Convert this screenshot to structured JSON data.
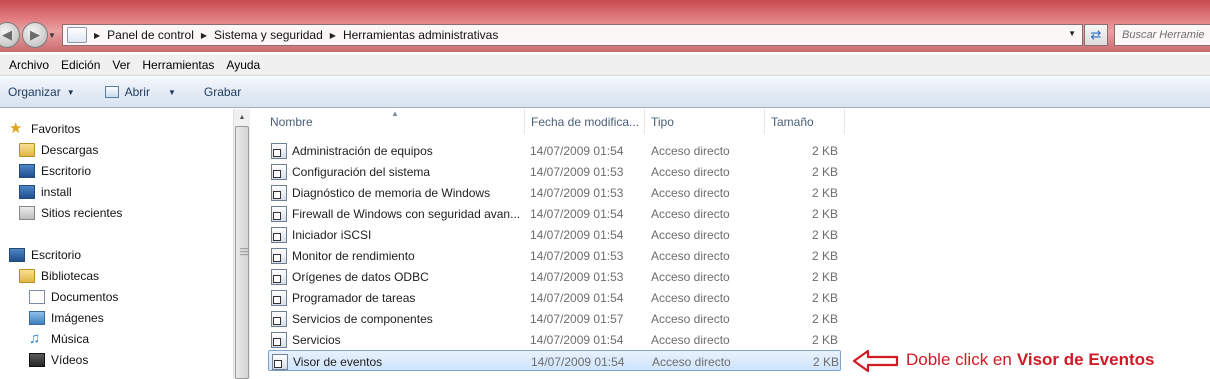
{
  "address": {
    "crumbs": [
      "Panel de control",
      "Sistema y seguridad",
      "Herramientas administrativas"
    ],
    "search_placeholder": "Buscar Herramie"
  },
  "menubar": [
    "Archivo",
    "Edición",
    "Ver",
    "Herramientas",
    "Ayuda"
  ],
  "commandbar": {
    "organize": "Organizar",
    "open": "Abrir",
    "burn": "Grabar"
  },
  "navpane": {
    "favorites": "Favoritos",
    "downloads": "Descargas",
    "desktop_fav": "Escritorio",
    "install": "install",
    "recent": "Sitios recientes",
    "desktop": "Escritorio",
    "libraries": "Bibliotecas",
    "documents": "Documentos",
    "images": "Imágenes",
    "music": "Música",
    "videos": "Vídeos"
  },
  "columns": {
    "name": "Nombre",
    "date": "Fecha de modifica...",
    "type": "Tipo",
    "size": "Tamaño"
  },
  "files": [
    {
      "name": "Administración de equipos",
      "date": "14/07/2009 01:54",
      "type": "Acceso directo",
      "size": "2 KB"
    },
    {
      "name": "Configuración del sistema",
      "date": "14/07/2009 01:53",
      "type": "Acceso directo",
      "size": "2 KB"
    },
    {
      "name": "Diagnóstico de memoria de Windows",
      "date": "14/07/2009 01:53",
      "type": "Acceso directo",
      "size": "2 KB"
    },
    {
      "name": "Firewall de Windows con seguridad avan...",
      "date": "14/07/2009 01:54",
      "type": "Acceso directo",
      "size": "2 KB"
    },
    {
      "name": "Iniciador iSCSI",
      "date": "14/07/2009 01:54",
      "type": "Acceso directo",
      "size": "2 KB"
    },
    {
      "name": "Monitor de rendimiento",
      "date": "14/07/2009 01:53",
      "type": "Acceso directo",
      "size": "2 KB"
    },
    {
      "name": "Orígenes de datos ODBC",
      "date": "14/07/2009 01:53",
      "type": "Acceso directo",
      "size": "2 KB"
    },
    {
      "name": "Programador de tareas",
      "date": "14/07/2009 01:54",
      "type": "Acceso directo",
      "size": "2 KB"
    },
    {
      "name": "Servicios de componentes",
      "date": "14/07/2009 01:57",
      "type": "Acceso directo",
      "size": "2 KB"
    },
    {
      "name": "Servicios",
      "date": "14/07/2009 01:54",
      "type": "Acceso directo",
      "size": "2 KB"
    },
    {
      "name": "Visor de eventos",
      "date": "14/07/2009 01:54",
      "type": "Acceso directo",
      "size": "2 KB"
    }
  ],
  "annotation": {
    "prefix": "Doble click en",
    "bold": "Visor de Eventos",
    "color": "#d11a24"
  }
}
